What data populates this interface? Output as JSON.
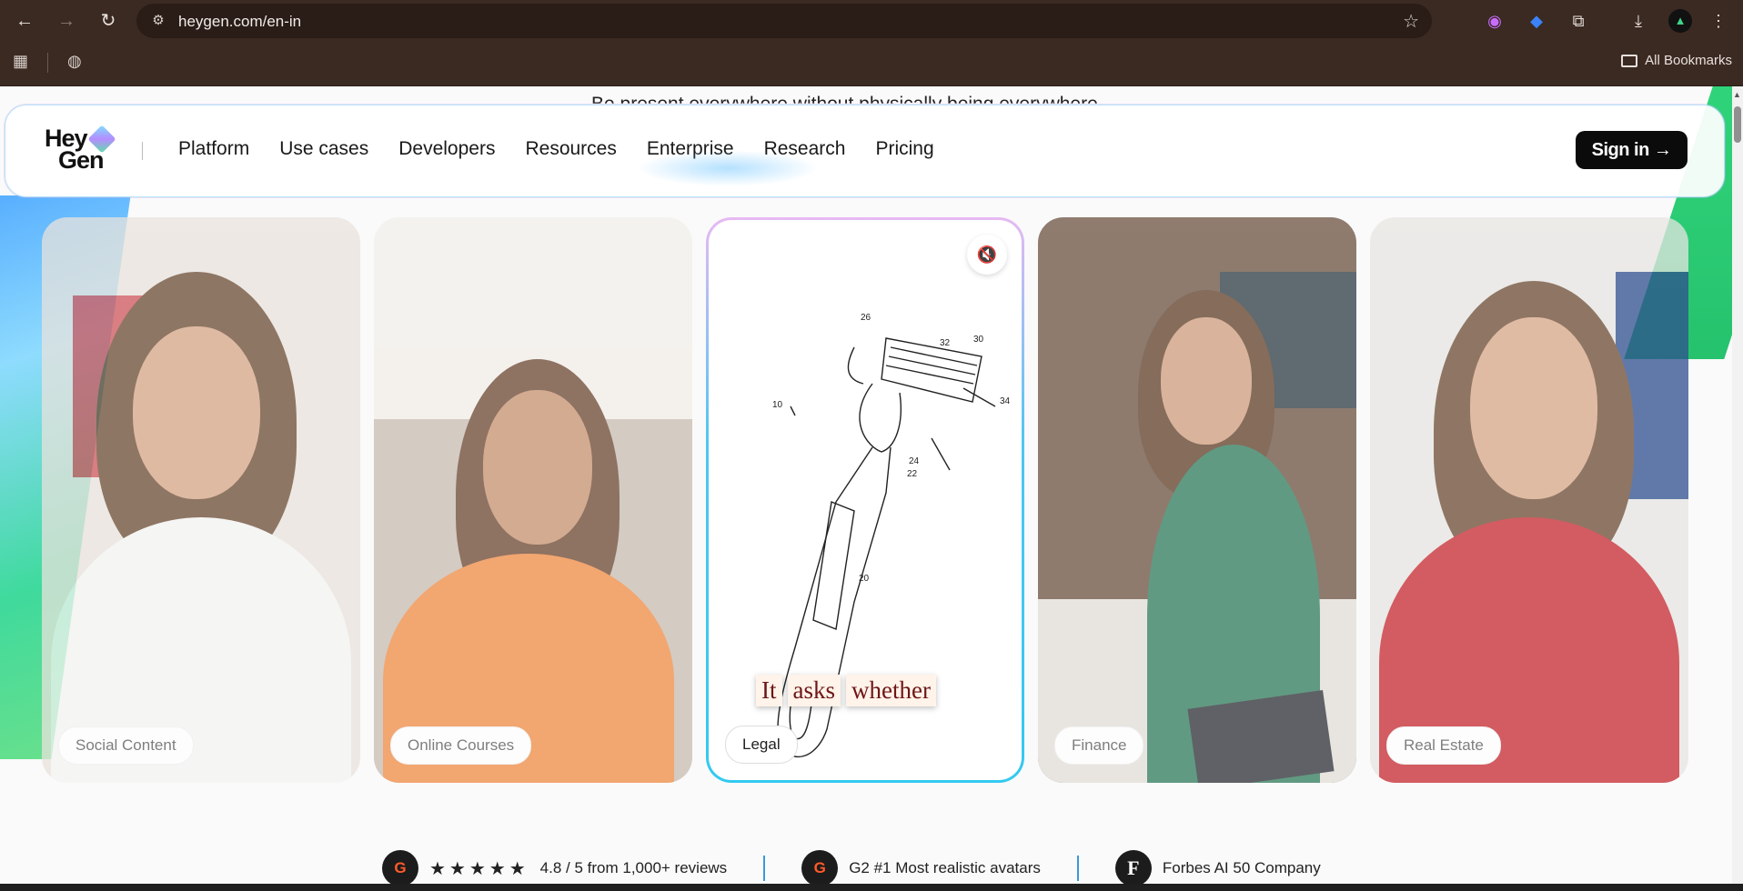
{
  "browser": {
    "url": "heygen.com/en-in",
    "bookmarks_label": "All Bookmarks"
  },
  "page": {
    "banner": "Be present everywhere without physically being everywhere",
    "logo": {
      "line1": "Hey",
      "line2": "Gen"
    },
    "nav": [
      "Platform",
      "Use cases",
      "Developers",
      "Resources",
      "Enterprise",
      "Research",
      "Pricing"
    ],
    "signin_label": "Sign in →",
    "cards": [
      {
        "label": "Social Content"
      },
      {
        "label": "Online Courses"
      },
      {
        "label": "Legal"
      },
      {
        "label": "Finance"
      },
      {
        "label": "Real Estate"
      }
    ],
    "caption_words": [
      "It",
      "asks",
      "whether"
    ],
    "patent_numbers": [
      "26",
      "32",
      "30",
      "34",
      "10",
      "24",
      "22",
      "20"
    ],
    "stats": [
      {
        "badge": "G",
        "stars": "★★★★★",
        "text": "4.8 / 5 from 1,000+ reviews"
      },
      {
        "badge": "G",
        "text": "G2 #1 Most realistic avatars"
      },
      {
        "badge": "F",
        "text": "Forbes AI 50 Company"
      }
    ]
  },
  "colors": {
    "chrome": "#3b2a22",
    "accent_blue": "#33c9f0",
    "accent_green": "#2fd47a",
    "signin_bg": "#0b0b0b"
  },
  "icons": [
    "back-arrow-icon",
    "forward-arrow-icon",
    "reload-icon",
    "site-settings-icon",
    "star-icon",
    "extension-icon",
    "download-icon",
    "menu-icon",
    "apps-icon",
    "globe-icon",
    "folder-icon",
    "mute-icon"
  ]
}
